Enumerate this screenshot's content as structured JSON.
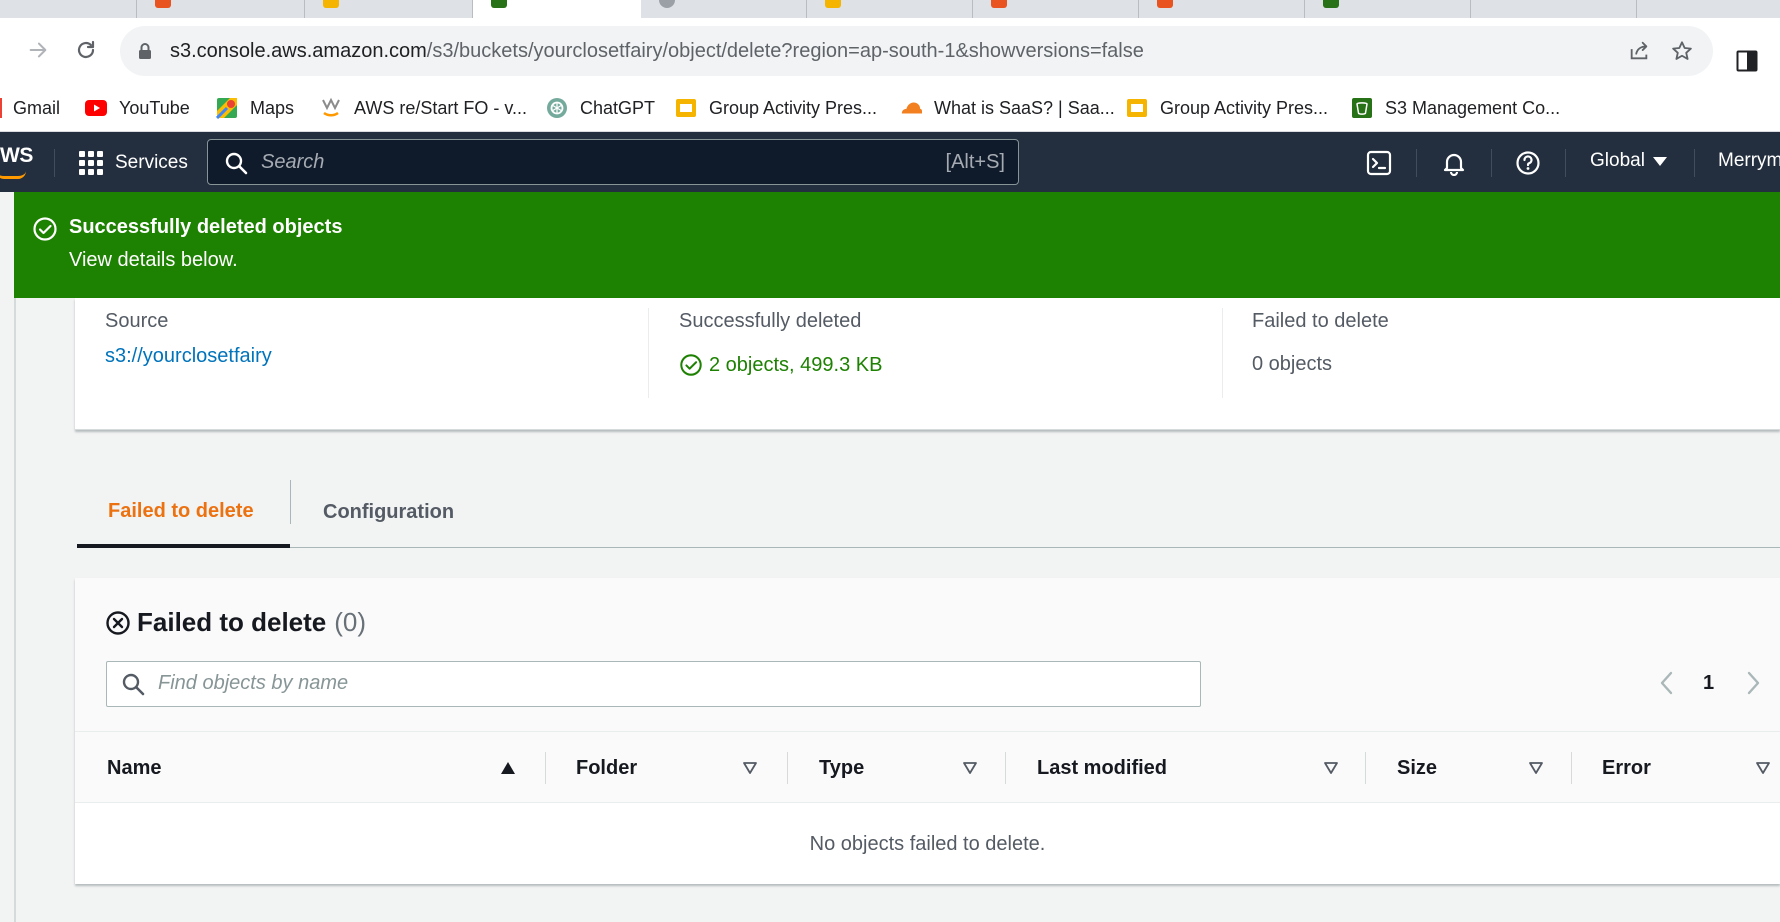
{
  "browser": {
    "url_host": "s3.console.aws.amazon.com",
    "url_path": "/s3/buckets/yourclosetfairy/object/delete?region=ap-south-1&showversions=false",
    "bookmarks": [
      {
        "label": "Gmail",
        "icon": "gmail-icon"
      },
      {
        "label": "YouTube",
        "icon": "youtube-icon"
      },
      {
        "label": "Maps",
        "icon": "maps-icon"
      },
      {
        "label": "AWS re/Start FO - v...",
        "icon": "aws-restart-icon"
      },
      {
        "label": "ChatGPT",
        "icon": "chatgpt-icon"
      },
      {
        "label": "Group Activity Pres...",
        "icon": "slides-icon"
      },
      {
        "label": "What is SaaS? | Saa...",
        "icon": "cloudflare-icon"
      },
      {
        "label": "Group Activity Pres...",
        "icon": "slides-icon"
      },
      {
        "label": "S3 Management Co...",
        "icon": "s3-icon"
      }
    ]
  },
  "aws_nav": {
    "logo": "WS",
    "services": "Services",
    "search_placeholder": "Search",
    "search_shortcut": "[Alt+S]",
    "region": "Global",
    "user": "Merrym"
  },
  "flash": {
    "title": "Successfully deleted objects",
    "description": "View details below."
  },
  "summary": {
    "source_label": "Source",
    "source_value": "s3://yourclosetfairy",
    "deleted_label": "Successfully deleted",
    "deleted_value": "2 objects, 499.3 KB",
    "failed_label": "Failed to delete",
    "failed_value": "0 objects"
  },
  "tabs": [
    {
      "label": "Failed to delete",
      "active": true
    },
    {
      "label": "Configuration",
      "active": false
    }
  ],
  "failed_table": {
    "title": "Failed to delete",
    "count": "(0)",
    "filter_placeholder": "Find objects by name",
    "current_page": "1",
    "columns": [
      "Name",
      "Folder",
      "Type",
      "Last modified",
      "Size",
      "Error"
    ],
    "empty_message": "No objects failed to delete."
  },
  "colors": {
    "success_green": "#1d8102",
    "aws_nav_bg": "#232f3e",
    "link_blue": "#0073bb",
    "active_tab_orange": "#ec7211"
  }
}
